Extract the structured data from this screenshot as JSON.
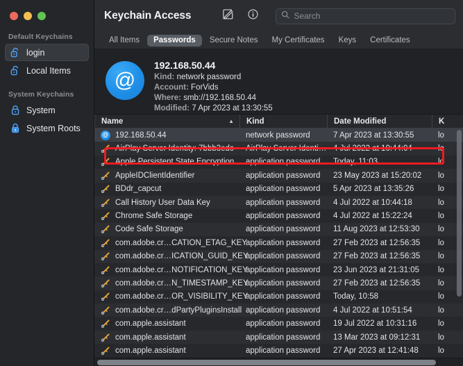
{
  "window": {
    "traffic_lights": [
      "close",
      "minimize",
      "maximize"
    ],
    "colors": {
      "close": "#ec6a5f",
      "minimize": "#f4bd50",
      "maximize": "#61c554",
      "accent_blue": "#1f8fe8",
      "annotation_red": "#ee1b20",
      "selected_row": "#3c4046"
    }
  },
  "sidebar": {
    "groups": [
      {
        "title": "Default Keychains",
        "items": [
          {
            "label": "login",
            "icon": "unlocked-padlock-icon",
            "selected": true
          },
          {
            "label": "Local Items",
            "icon": "unlocked-padlock-icon",
            "selected": false
          }
        ]
      },
      {
        "title": "System Keychains",
        "items": [
          {
            "label": "System",
            "icon": "locked-padlock-icon",
            "selected": false
          },
          {
            "label": "System Roots",
            "icon": "filled-padlock-icon",
            "selected": false
          }
        ]
      }
    ]
  },
  "toolbar": {
    "title": "Keychain Access",
    "compose_icon": "compose-icon",
    "info_icon": "info-icon",
    "search": {
      "icon": "search-icon",
      "value": "",
      "placeholder": "Search"
    }
  },
  "tabs": [
    {
      "label": "All Items",
      "selected": false
    },
    {
      "label": "Passwords",
      "selected": true
    },
    {
      "label": "Secure Notes",
      "selected": false
    },
    {
      "label": "My Certificates",
      "selected": false
    },
    {
      "label": "Keys",
      "selected": false
    },
    {
      "label": "Certificates",
      "selected": false
    }
  ],
  "detail": {
    "icon": "at-sign-icon",
    "title": "192.168.50.44",
    "fields": [
      {
        "label": "Kind:",
        "value": "network password"
      },
      {
        "label": "Account:",
        "value": "ForVids"
      },
      {
        "label": "Where:",
        "value": "smb://192.168.50.44"
      },
      {
        "label": "Modified:",
        "value": "7 Apr 2023 at 13:30:55"
      }
    ]
  },
  "table": {
    "columns": [
      {
        "label": "Name",
        "sorted": "ascending",
        "sort_glyph": "▲"
      },
      {
        "label": "Kind",
        "sorted": "",
        "sort_glyph": ""
      },
      {
        "label": "Date Modified",
        "sorted": "",
        "sort_glyph": ""
      },
      {
        "label": "K",
        "sorted": "",
        "sort_glyph": ""
      }
    ],
    "rows": [
      {
        "icon": "at-sign-icon",
        "name": "192.168.50.44",
        "kind": "network password",
        "date": "7 Apr 2023 at 13:30:55",
        "keychain": "lo",
        "selected": true
      },
      {
        "icon": "key-icon",
        "name": "AirPlay Server Identity: 7bbb3edc",
        "kind": "AirPlay Server Identi…",
        "date": "4 Jul 2022 at 10:44:04",
        "keychain": "lo",
        "selected": false
      },
      {
        "icon": "key-icon",
        "name": "Apple Persistent State Encryption",
        "kind": "application password",
        "date": "Today, 11:03",
        "keychain": "lo",
        "selected": false
      },
      {
        "icon": "key-icon",
        "name": "AppleIDClientIdentifier",
        "kind": "application password",
        "date": "23 May 2023 at 15:20:02",
        "keychain": "lo",
        "selected": false
      },
      {
        "icon": "key-icon",
        "name": "BDdr_capcut",
        "kind": "application password",
        "date": "5 Apr 2023 at 13:35:26",
        "keychain": "lo",
        "selected": false
      },
      {
        "icon": "key-icon",
        "name": "Call History User Data Key",
        "kind": "application password",
        "date": "4 Jul 2022 at 10:44:18",
        "keychain": "lo",
        "selected": false
      },
      {
        "icon": "key-icon",
        "name": "Chrome Safe Storage",
        "kind": "application password",
        "date": "4 Jul 2022 at 15:22:24",
        "keychain": "lo",
        "selected": false
      },
      {
        "icon": "key-icon",
        "name": "Code Safe Storage",
        "kind": "application password",
        "date": "11 Aug 2023 at 12:53:30",
        "keychain": "lo",
        "selected": false
      },
      {
        "icon": "key-icon",
        "name": "com.adobe.cr…CATION_ETAG_KEY",
        "kind": "application password",
        "date": "27 Feb 2023 at 12:56:35",
        "keychain": "lo",
        "selected": false
      },
      {
        "icon": "key-icon",
        "name": "com.adobe.cr…ICATION_GUID_KEY",
        "kind": "application password",
        "date": "27 Feb 2023 at 12:56:35",
        "keychain": "lo",
        "selected": false
      },
      {
        "icon": "key-icon",
        "name": "com.adobe.cr…NOTIFICATION_KEY",
        "kind": "application password",
        "date": "23 Jun 2023 at 21:31:05",
        "keychain": "lo",
        "selected": false
      },
      {
        "icon": "key-icon",
        "name": "com.adobe.cr…N_TIMESTAMP_KEY",
        "kind": "application password",
        "date": "27 Feb 2023 at 12:56:35",
        "keychain": "lo",
        "selected": false
      },
      {
        "icon": "key-icon",
        "name": "com.adobe.cr…OR_VISIBILITY_KEY",
        "kind": "application password",
        "date": "Today, 10:58",
        "keychain": "lo",
        "selected": false
      },
      {
        "icon": "key-icon",
        "name": "com.adobe.cr…dPartyPluginsInstall",
        "kind": "application password",
        "date": "4 Jul 2022 at 10:51:54",
        "keychain": "lo",
        "selected": false
      },
      {
        "icon": "key-icon",
        "name": "com.apple.assistant",
        "kind": "application password",
        "date": "19 Jul 2022 at 10:31:16",
        "keychain": "lo",
        "selected": false
      },
      {
        "icon": "key-icon",
        "name": "com.apple.assistant",
        "kind": "application password",
        "date": "13 Mar 2023 at 09:12:31",
        "keychain": "lo",
        "selected": false
      },
      {
        "icon": "key-icon",
        "name": "com.apple.assistant",
        "kind": "application password",
        "date": "27 Apr 2023 at 12:41:48",
        "keychain": "lo",
        "selected": false
      }
    ]
  },
  "annotation": {
    "shape": "rectangle",
    "target": "192.168.50.44"
  }
}
